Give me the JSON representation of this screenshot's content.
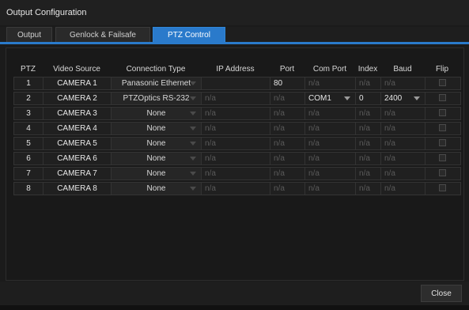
{
  "window": {
    "title": "Output Configuration"
  },
  "tabs": [
    {
      "label": "Output",
      "active": false
    },
    {
      "label": "Genlock & Failsafe",
      "active": false
    },
    {
      "label": "PTZ Control",
      "active": true
    }
  ],
  "table": {
    "columns": [
      "PTZ",
      "Video Source",
      "Connection Type",
      "IP Address",
      "Port",
      "Com Port",
      "Index",
      "Baud",
      "Flip"
    ],
    "rows": [
      {
        "ptz": "1",
        "source": "CAMERA 1",
        "connection": "Panasonic Ethernet",
        "ip": "",
        "port": "80",
        "com": "n/a",
        "index": "n/a",
        "baud": "n/a",
        "flip": false
      },
      {
        "ptz": "2",
        "source": "CAMERA 2",
        "connection": "PTZOptics RS-232",
        "ip": "n/a",
        "port": "n/a",
        "com": "COM1",
        "index": "0",
        "baud": "2400",
        "flip": false
      },
      {
        "ptz": "3",
        "source": "CAMERA 3",
        "connection": "None",
        "ip": "n/a",
        "port": "n/a",
        "com": "n/a",
        "index": "n/a",
        "baud": "n/a",
        "flip": false
      },
      {
        "ptz": "4",
        "source": "CAMERA 4",
        "connection": "None",
        "ip": "n/a",
        "port": "n/a",
        "com": "n/a",
        "index": "n/a",
        "baud": "n/a",
        "flip": false
      },
      {
        "ptz": "5",
        "source": "CAMERA 5",
        "connection": "None",
        "ip": "n/a",
        "port": "n/a",
        "com": "n/a",
        "index": "n/a",
        "baud": "n/a",
        "flip": false
      },
      {
        "ptz": "6",
        "source": "CAMERA 6",
        "connection": "None",
        "ip": "n/a",
        "port": "n/a",
        "com": "n/a",
        "index": "n/a",
        "baud": "n/a",
        "flip": false
      },
      {
        "ptz": "7",
        "source": "CAMERA 7",
        "connection": "None",
        "ip": "n/a",
        "port": "n/a",
        "com": "n/a",
        "index": "n/a",
        "baud": "n/a",
        "flip": false
      },
      {
        "ptz": "8",
        "source": "CAMERA 8",
        "connection": "None",
        "ip": "n/a",
        "port": "n/a",
        "com": "n/a",
        "index": "n/a",
        "baud": "n/a",
        "flip": false
      }
    ]
  },
  "footer": {
    "close_label": "Close"
  },
  "colors": {
    "accent": "#2a7acb",
    "background": "#1b1b1b"
  }
}
